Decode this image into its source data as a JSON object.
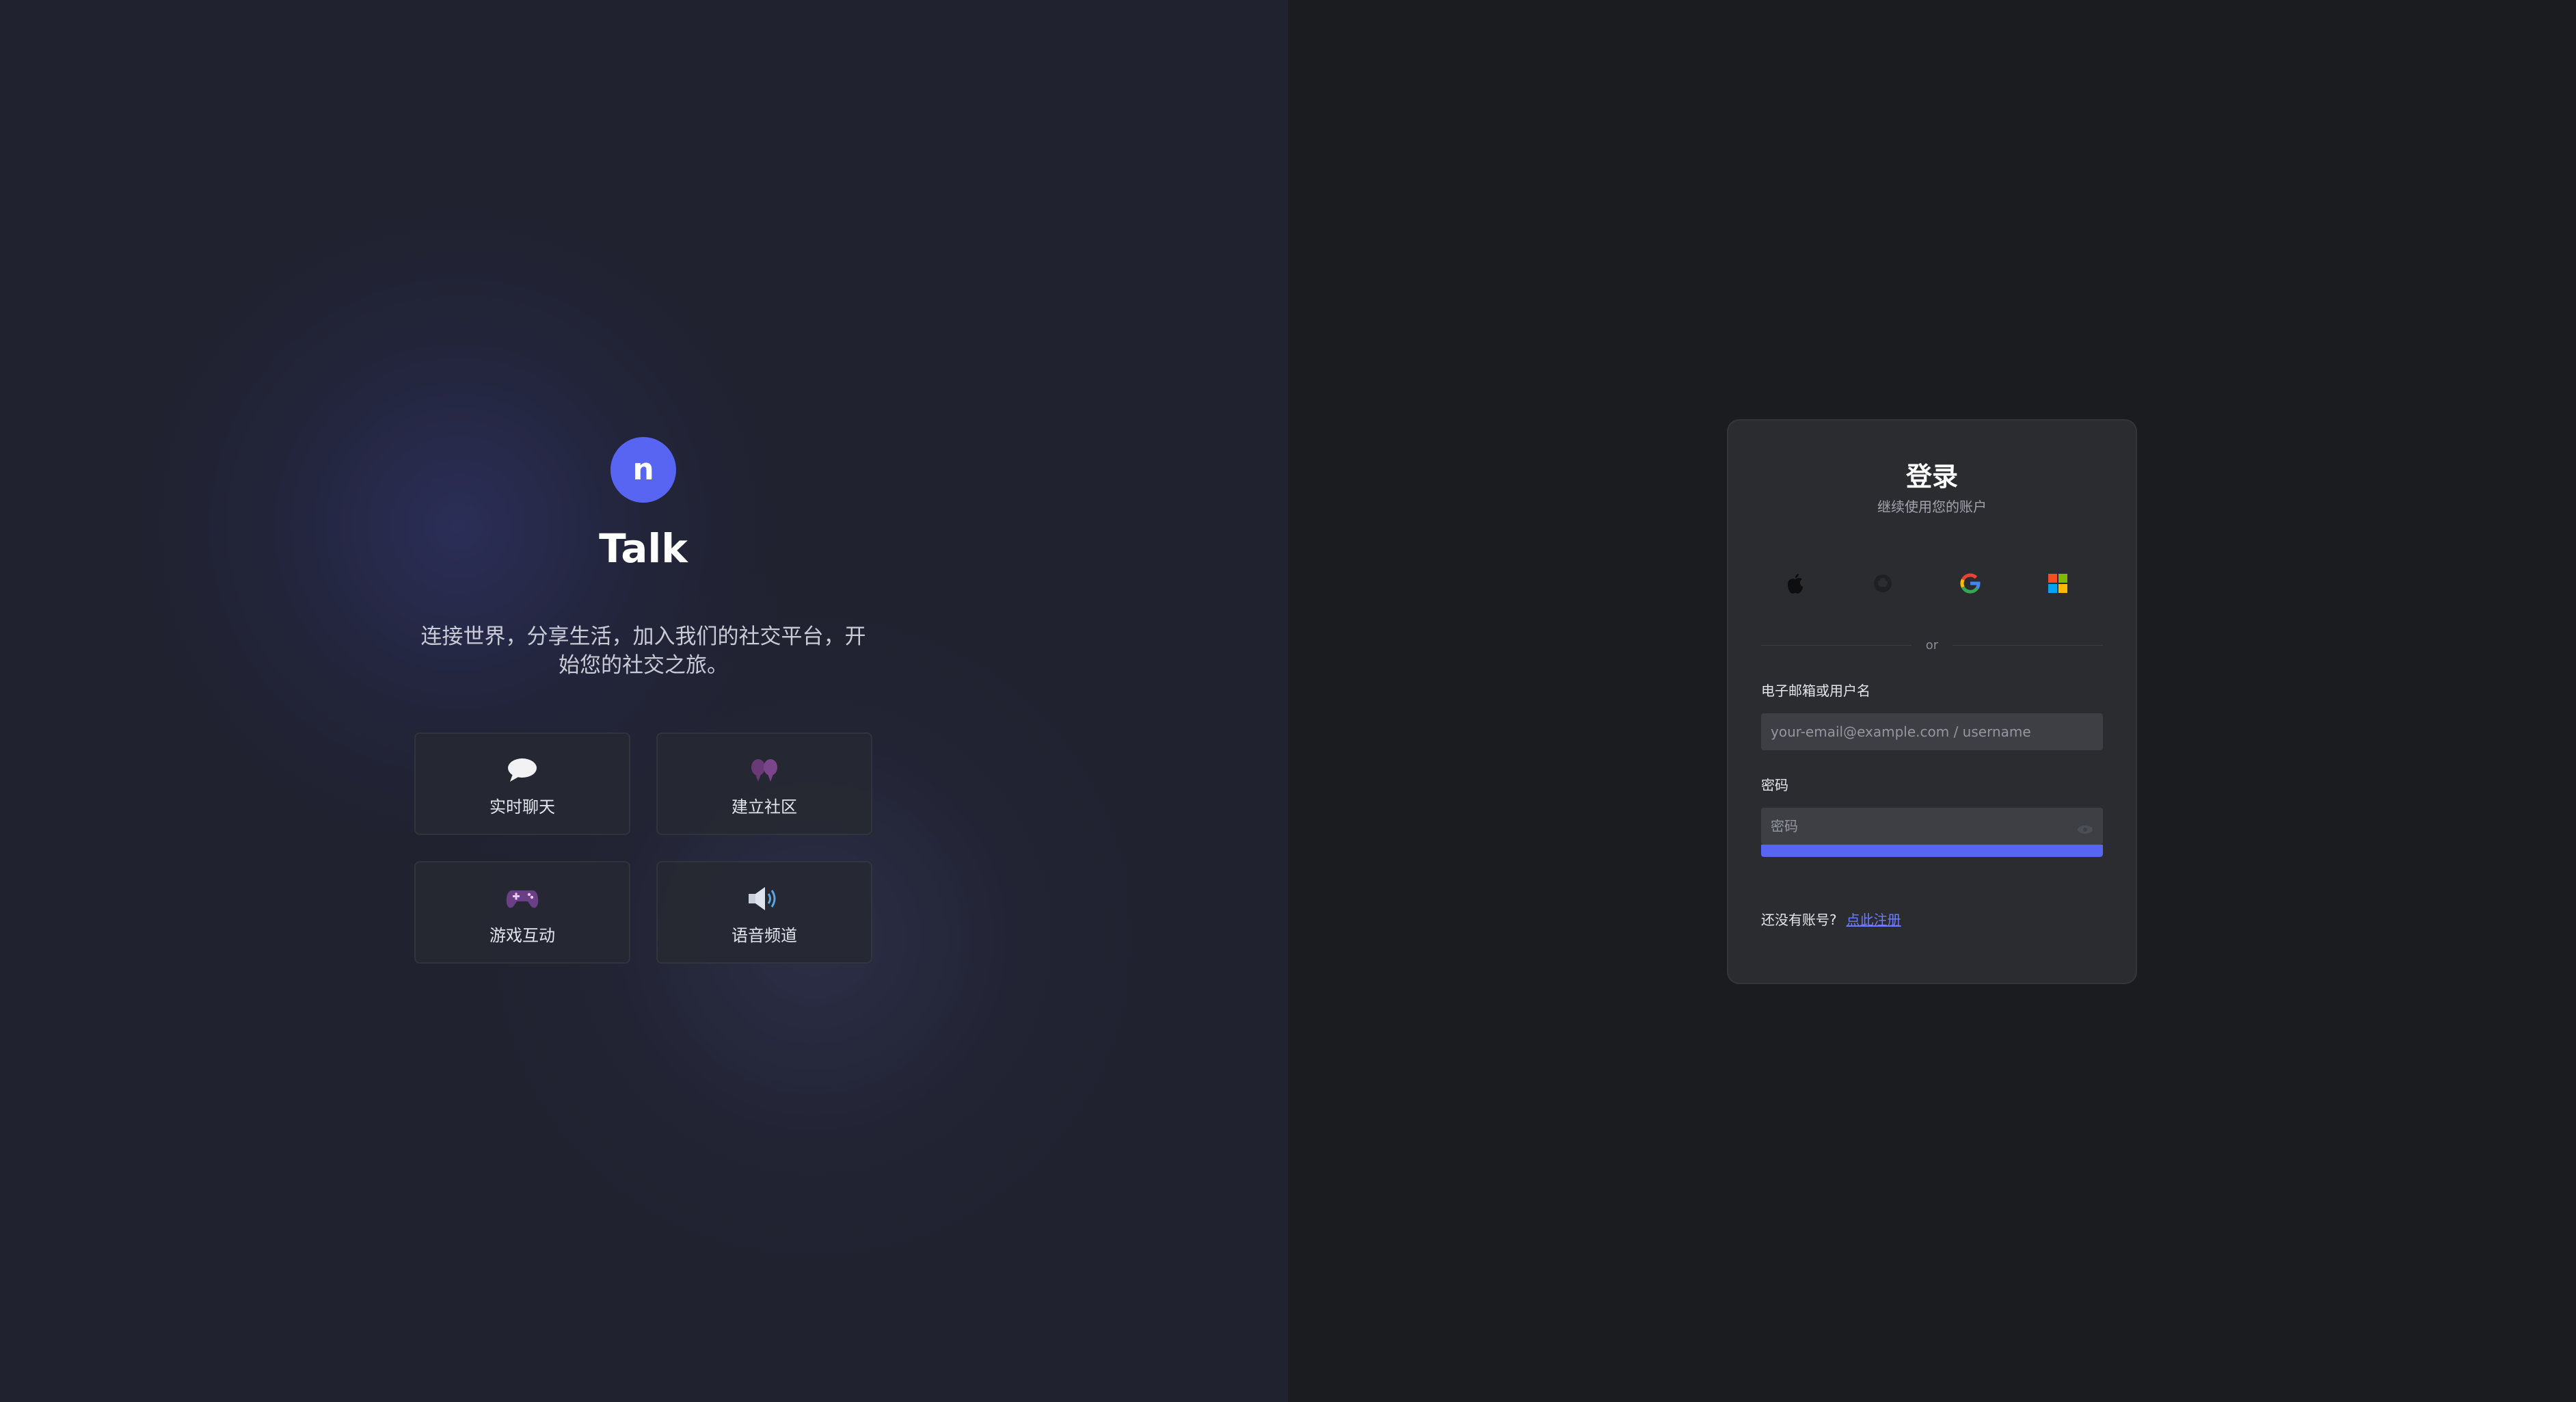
{
  "brand": {
    "logo_letter": "n",
    "name": "Talk",
    "tagline": "连接世界，分享生活，加入我们的社交平台，开始您的社交之旅。"
  },
  "features": [
    {
      "label": "实时聊天",
      "icon": "speech-bubble-icon"
    },
    {
      "label": "建立社区",
      "icon": "community-icon"
    },
    {
      "label": "游戏互动",
      "icon": "gamepad-icon"
    },
    {
      "label": "语音频道",
      "icon": "speaker-icon"
    }
  ],
  "login": {
    "title": "登录",
    "subtitle": "继续使用您的账户",
    "social": [
      {
        "name": "apple",
        "icon": "apple-icon"
      },
      {
        "name": "github",
        "icon": "github-icon"
      },
      {
        "name": "google",
        "icon": "google-icon"
      },
      {
        "name": "microsoft",
        "icon": "microsoft-icon"
      }
    ],
    "divider_text": "or",
    "identifier": {
      "label": "电子邮箱或用户名",
      "placeholder": "your-email@example.com / username",
      "value": ""
    },
    "password": {
      "label": "密码",
      "placeholder": "密码",
      "value": ""
    },
    "register_prompt": "还没有账号?",
    "register_link": "点此注册"
  },
  "colors": {
    "accent": "#5865f2",
    "left_background": "#20222f",
    "right_background": "#1b1c1f",
    "card_background": "#2b2c30",
    "link": "#6f7bff"
  }
}
